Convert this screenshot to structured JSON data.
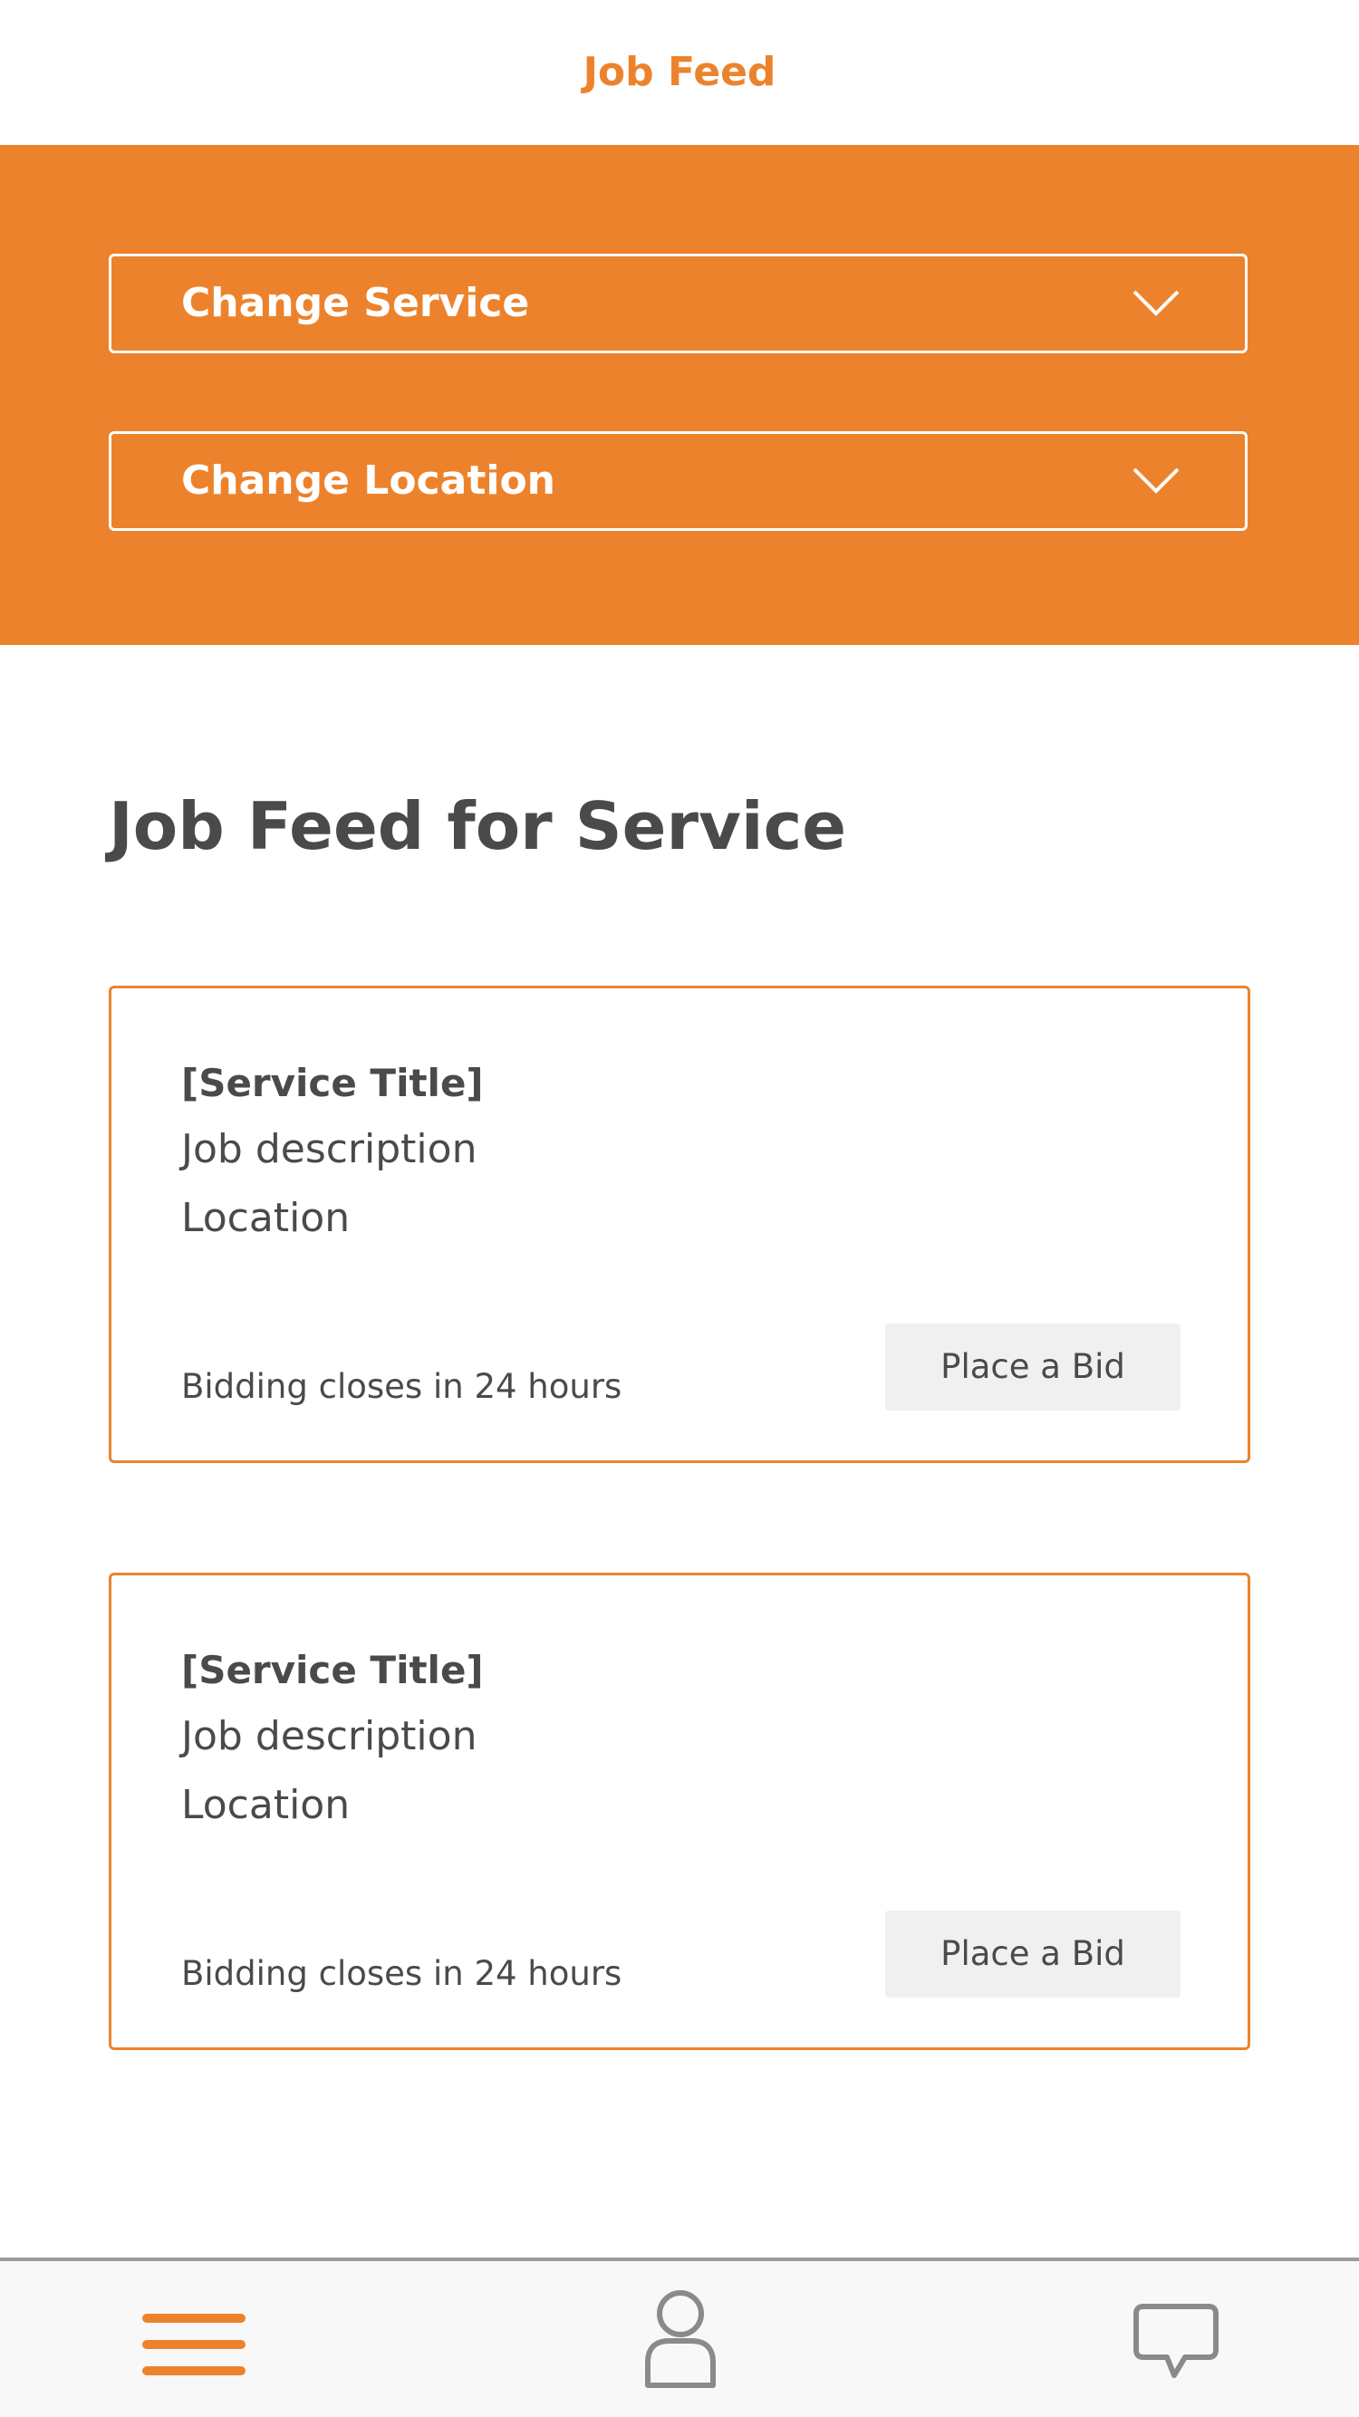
{
  "header": {
    "title": "Job Feed"
  },
  "filters": {
    "service_label": "Change Service",
    "location_label": "Change Location"
  },
  "main": {
    "heading": "Job Feed for Service",
    "jobs": [
      {
        "title": "[Service Title]",
        "description": "Job description",
        "location": "Location",
        "deadline": "Bidding closes in 24 hours",
        "bid_label": "Place a Bid"
      },
      {
        "title": "[Service Title]",
        "description": "Job description",
        "location": "Location",
        "deadline": "Bidding closes in 24 hours",
        "bid_label": "Place a Bid"
      }
    ]
  },
  "tabbar": {
    "items": [
      {
        "icon": "hamburger-menu-icon",
        "active": true
      },
      {
        "icon": "profile-icon",
        "active": false
      },
      {
        "icon": "chat-bubble-icon",
        "active": false
      }
    ]
  },
  "colors": {
    "accent": "#ec832c",
    "text": "#4a4a4a",
    "button_bg": "#f0f0f0",
    "tabbar_bg": "#f8f8f8",
    "icon_inactive": "#8a8a8a"
  }
}
